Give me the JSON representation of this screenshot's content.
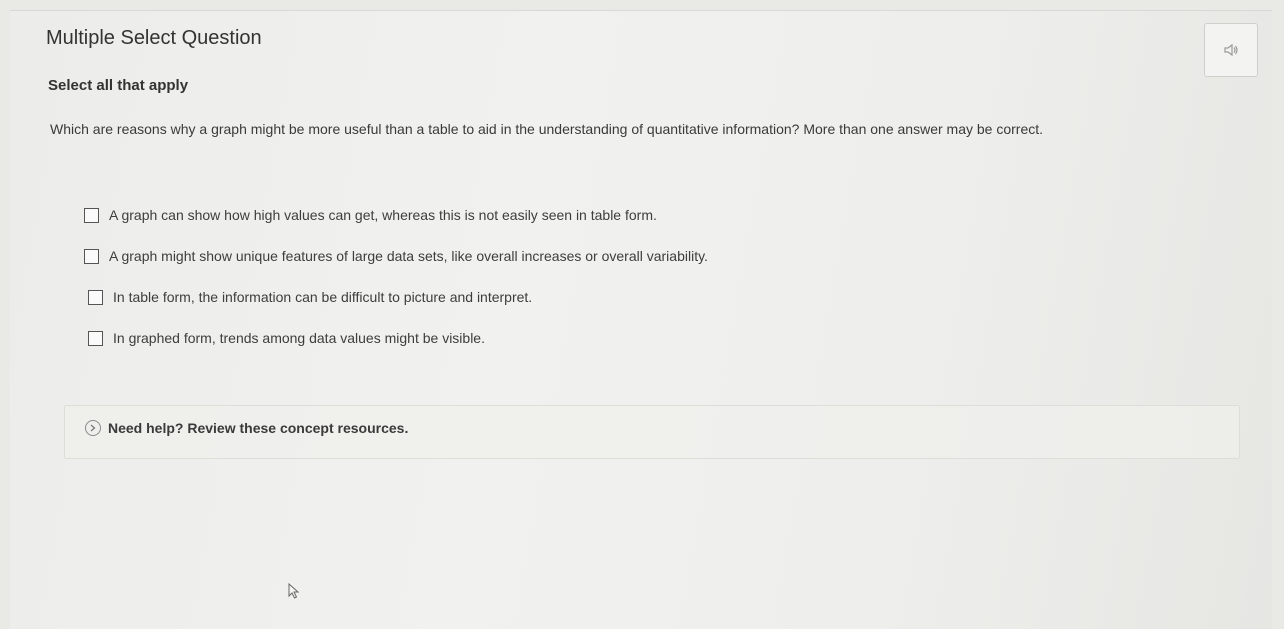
{
  "question": {
    "type_label": "Multiple Select Question",
    "instruction": "Select all that apply",
    "prompt": "Which are reasons why a graph might be more useful than a table to aid in the understanding of quantitative information? More than one answer may be correct."
  },
  "audio": {
    "icon": "speaker-icon"
  },
  "options": [
    {
      "label": "A graph can show how high values can get, whereas this is not easily seen in table form.",
      "checked": false
    },
    {
      "label": "A graph might show unique features of large data sets, like overall increases or overall variability.",
      "checked": false
    },
    {
      "label": "In table form, the information can be difficult to picture and interpret.",
      "checked": false
    },
    {
      "label": "In graphed form, trends among data values might be visible.",
      "checked": false
    }
  ],
  "help": {
    "icon": "chevron-right-circle-icon",
    "label": "Need help? Review these concept resources."
  },
  "colors": {
    "background": "#ececea",
    "text": "#333333",
    "border": "#cfcfcb"
  }
}
